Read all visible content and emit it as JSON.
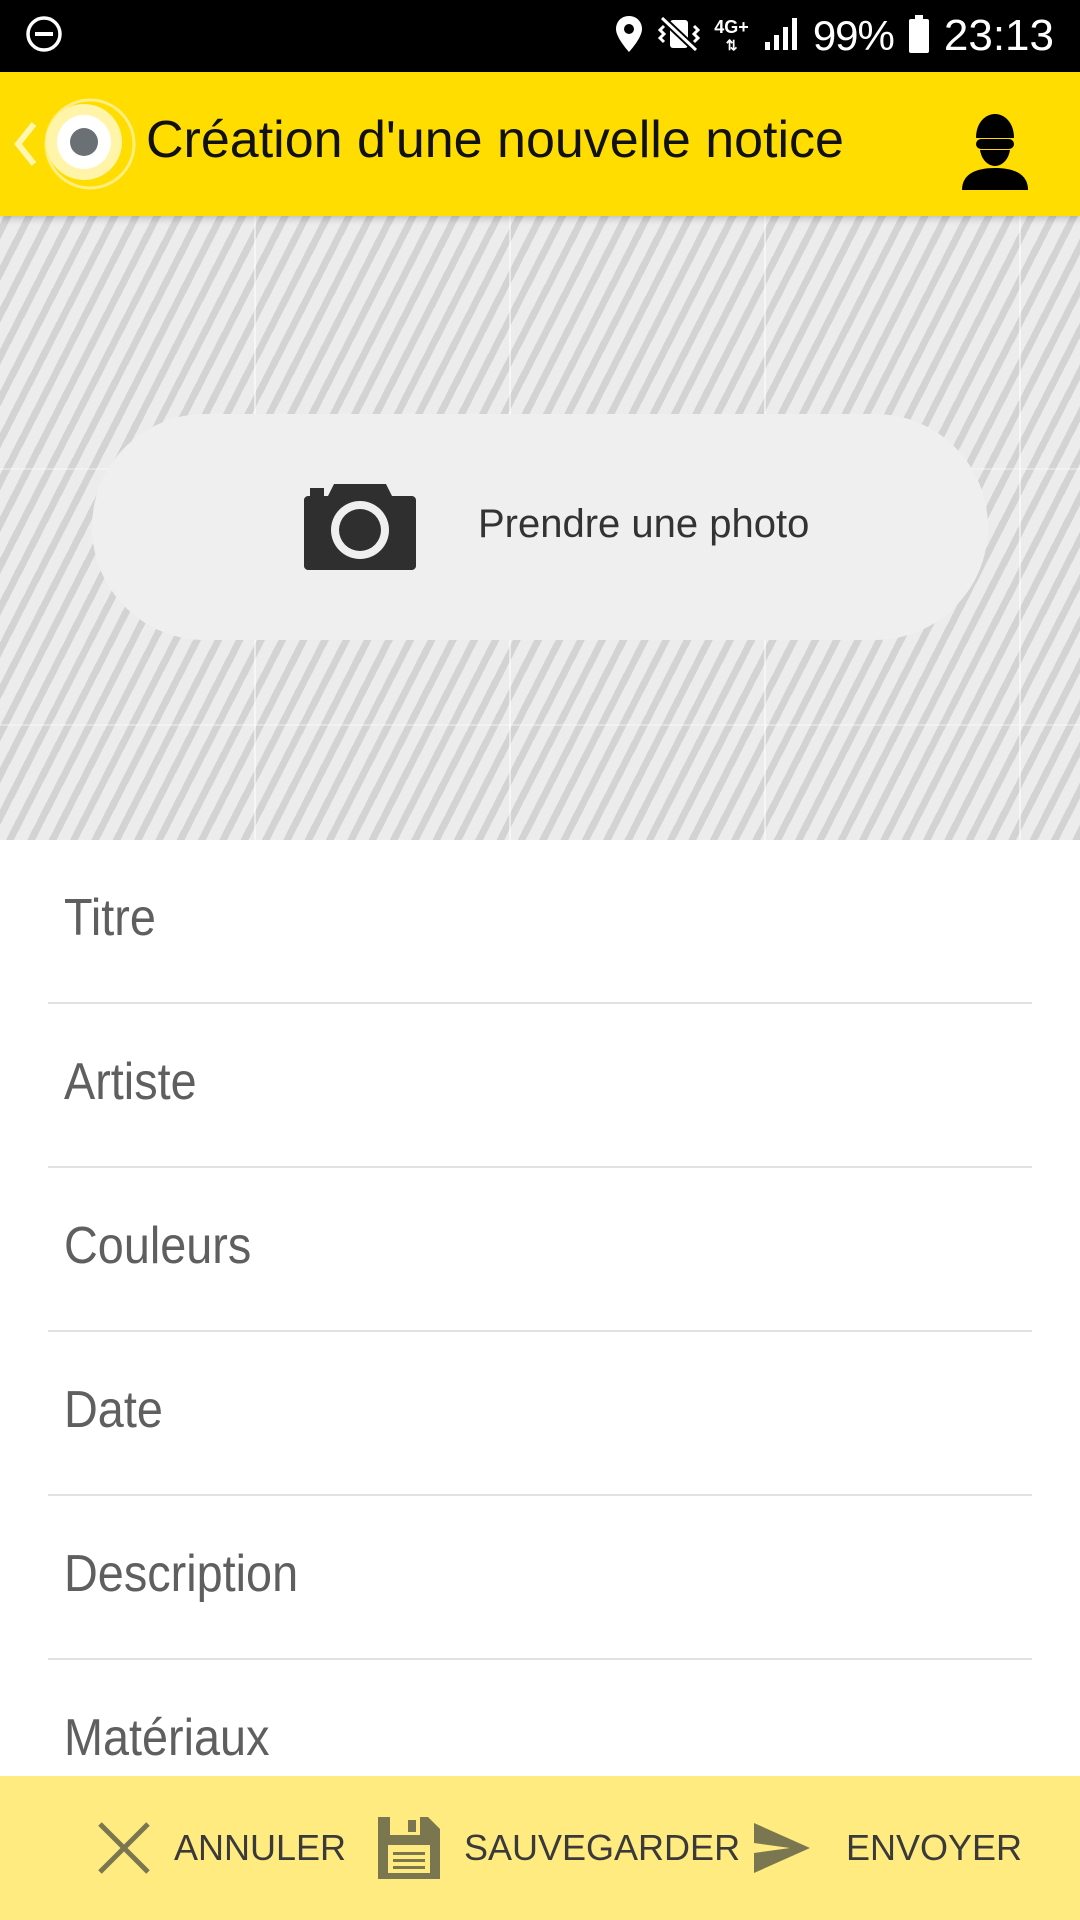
{
  "status_bar": {
    "network_type": "4G+",
    "battery": "99%",
    "time": "23:13"
  },
  "app_bar": {
    "title": "Création d'une nouvelle notice",
    "brand_color": "#ffdd00"
  },
  "photo": {
    "button_label": "Prendre une photo",
    "icon": "camera-icon"
  },
  "form": {
    "fields": [
      {
        "label": "Titre"
      },
      {
        "label": "Artiste"
      },
      {
        "label": "Couleurs"
      },
      {
        "label": "Date"
      },
      {
        "label": "Description"
      },
      {
        "label": "Matériaux"
      }
    ]
  },
  "bottom_bar": {
    "background_color": "#ffeb80",
    "cancel_label": "ANNULER",
    "save_label": "SAUVEGARDER",
    "send_label": "ENVOYER"
  }
}
